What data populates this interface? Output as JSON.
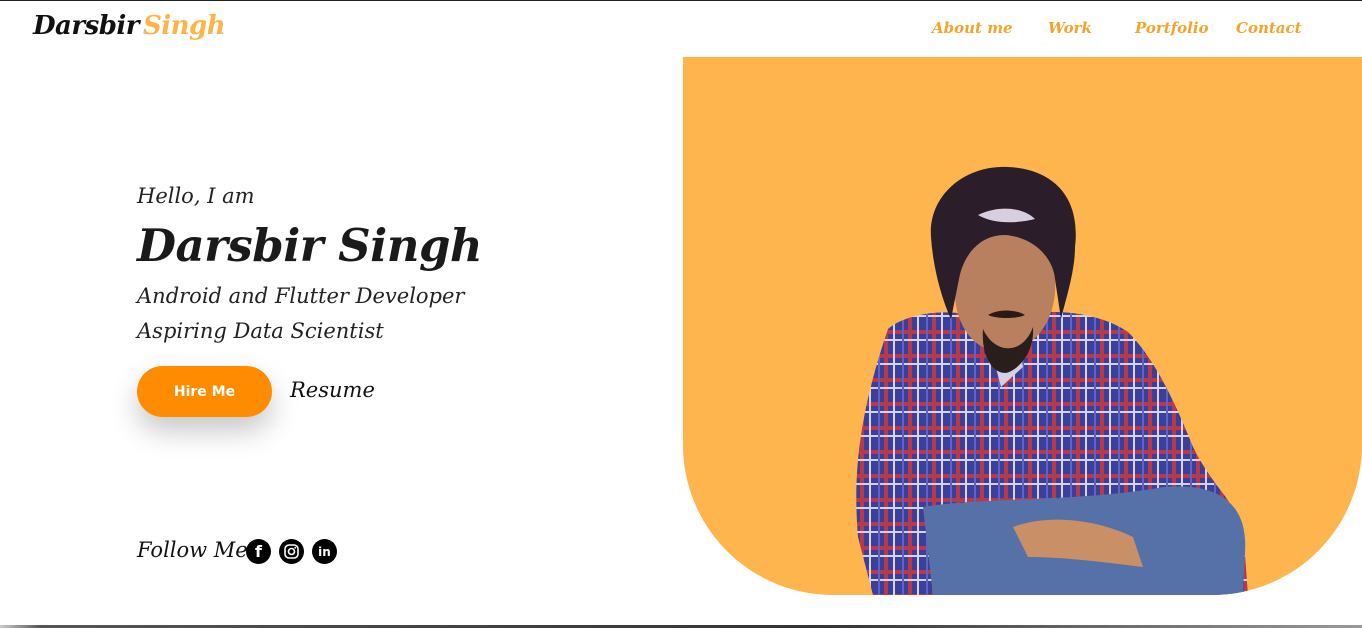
{
  "header": {
    "logo_first": "Darsbir",
    "logo_last": "Singh",
    "nav": [
      "About me",
      "Work",
      "Portfolio",
      "Contact"
    ]
  },
  "hero": {
    "greeting": "Hello, I am",
    "name": "Darsbir Singh",
    "role_line1": "Android and Flutter Developer",
    "role_line2": "Aspiring Data Scientist",
    "hire_button": "Hire Me",
    "resume_link": "Resume",
    "follow_label": "Follow Me"
  },
  "social": [
    {
      "icon": "facebook-icon",
      "glyph": "f"
    },
    {
      "icon": "instagram-icon"
    },
    {
      "icon": "linkedin-icon",
      "glyph": "in"
    }
  ],
  "colors": {
    "accent": "#ffb54d",
    "button": "#ff8c00",
    "nav_link": "#f4a42a"
  }
}
